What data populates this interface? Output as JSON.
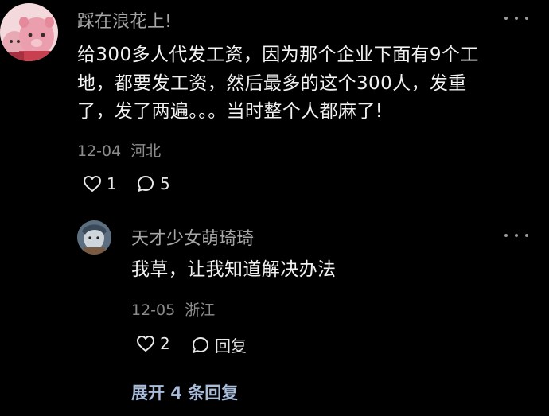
{
  "comments": [
    {
      "username": "踩在浪花上!",
      "lines": [
        "给300多人代发工资，因为那个企业下面有9个工",
        "地，都要发工资，然后最多的这个300人，发重",
        "了，发了两遍。。。当时整个人都麻了!"
      ],
      "date": "12-04",
      "location": "河北",
      "likes": "1",
      "replies": "5"
    },
    {
      "username": "天才少女萌琦琦",
      "text": "我草，让我知道解决办法",
      "date": "12-05",
      "location": "浙江",
      "likes": "2",
      "reply_label": "回复"
    }
  ],
  "expand_replies": "展开 4 条回复",
  "colors": {
    "background": "#000000",
    "username": "#a6a6a6",
    "meta": "#8c8c8c",
    "expand_link": "#a9bcd9"
  }
}
